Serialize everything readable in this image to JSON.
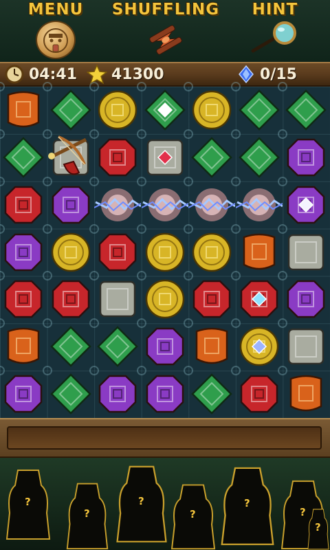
{
  "top_menu": {
    "menu_label": "MENU",
    "shuffle_label": "SHUFFLING",
    "hint_label": "HINT",
    "menu_icon": "sun-mask-icon",
    "shuffle_icon": "hourglass-icon",
    "hint_icon": "magnifier-icon"
  },
  "status": {
    "timer": "04:41",
    "score": "41300",
    "gems": "0/15",
    "timer_icon": "clock-icon",
    "score_icon": "star-icon",
    "gems_icon": "diamond-icon"
  },
  "board": {
    "columns": 7,
    "rows": 7,
    "grid": [
      [
        "orange-shield",
        "green-diamond",
        "yellow-coin",
        "green-diamond-gem",
        "yellow-coin",
        "green-diamond",
        "green-diamond"
      ],
      [
        "green-diamond",
        "silver-square",
        "red-octagon",
        "silver-square-gem",
        "green-diamond",
        "green-diamond",
        "purple-octagon"
      ],
      [
        "red-octagon",
        "purple-octagon",
        "lightning",
        "lightning",
        "lightning",
        "lightning",
        "purple-octagon-gem"
      ],
      [
        "purple-octagon",
        "yellow-coin",
        "red-octagon",
        "yellow-coin",
        "yellow-coin",
        "orange-shield",
        "silver-square"
      ],
      [
        "red-octagon",
        "red-octagon",
        "silver-square",
        "yellow-coin",
        "red-octagon",
        "red-octagon-gem",
        "purple-octagon"
      ],
      [
        "orange-shield",
        "green-diamond",
        "green-diamond",
        "purple-octagon",
        "orange-shield",
        "yellow-coin-gem",
        "silver-square"
      ],
      [
        "purple-octagon",
        "green-diamond",
        "purple-octagon",
        "purple-octagon",
        "green-diamond",
        "red-octagon",
        "orange-shield"
      ]
    ],
    "crossbow_cell": "row 2, col 2",
    "colors": {
      "red": "#c7262b",
      "orange": "#d9621b",
      "yellow": "#d8b526",
      "green": "#2f9e4c",
      "purple": "#8a3bc4",
      "silver": "#a9aca0"
    }
  },
  "progress": {
    "fraction": 0.0
  },
  "characters": {
    "count": 7,
    "mark": "?"
  }
}
